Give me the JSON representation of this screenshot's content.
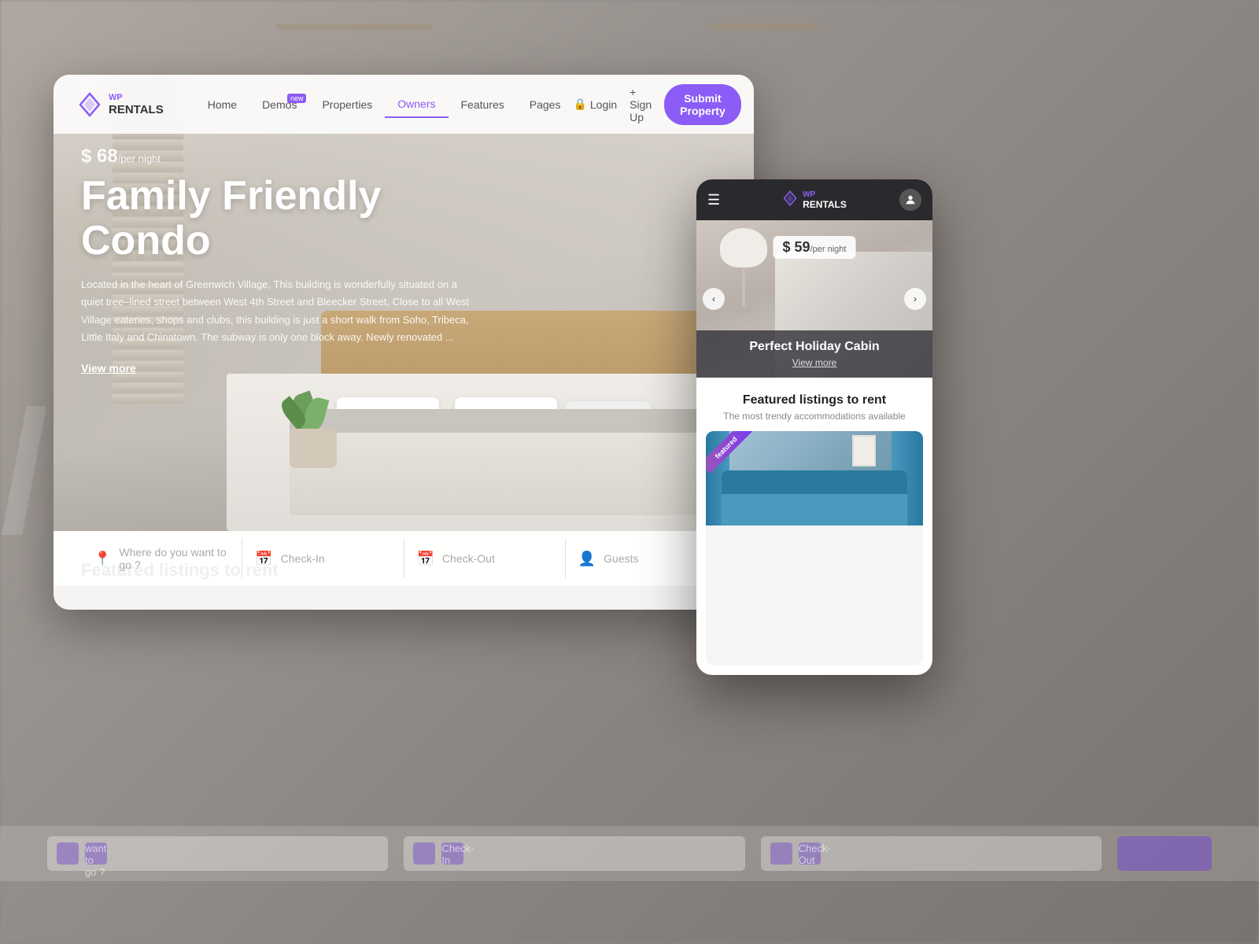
{
  "meta": {
    "title": "WP Rentals - Family Friendly Condo",
    "dimensions": "1600x1200"
  },
  "background": {
    "text": "/ R"
  },
  "desktop": {
    "navbar": {
      "logo": {
        "wp": "WP",
        "rentals": "RENTALS"
      },
      "links": [
        {
          "label": "Home",
          "active": false
        },
        {
          "label": "Demos",
          "active": false,
          "badge": "new"
        },
        {
          "label": "Properties",
          "active": false
        },
        {
          "label": "Owners",
          "active": true
        },
        {
          "label": "Features",
          "active": false
        },
        {
          "label": "Pages",
          "active": false
        }
      ],
      "login_label": "Login",
      "signup_label": "+ Sign Up",
      "submit_label": "Submit Property"
    },
    "hero": {
      "price": "$ 68",
      "price_unit": "/per night",
      "title": "Family Friendly Condo",
      "description": "Located in the heart of Greenwich Village, This building is wonderfully situated on a quiet tree–lined street between West 4th Street and Bleecker Street, Close to all West Village eateries, shops and clubs, this building is just a short walk from Soho, Tribeca, Little Italy and Chinatown. The subway is only one block away. Newly renovated ...",
      "view_more": "View more"
    },
    "search_bar": {
      "location_placeholder": "Where do you want to go ?",
      "checkin_placeholder": "Check-In",
      "checkout_placeholder": "Check-Out",
      "guests_placeholder": "Guests"
    },
    "featured_section": {
      "title": "Featured listings to rent"
    }
  },
  "mobile": {
    "navbar": {
      "wp": "WP",
      "rentals": "RENTALS",
      "menu_icon": "☰",
      "user_icon": "👤"
    },
    "hero": {
      "price": "$ 59",
      "price_unit": "/per night",
      "title": "Perfect Holiday Cabin",
      "view_more": "View more"
    },
    "featured": {
      "title": "Featured listings to rent",
      "subtitle": "The most trendy accommodations available"
    },
    "listing_badge": "featured",
    "arrows": {
      "left": "‹",
      "right": "›"
    }
  },
  "colors": {
    "primary": "#8b5cf6",
    "dark_bg": "#2a2a2e",
    "white": "#ffffff",
    "text_dark": "#333333",
    "text_mid": "#666666",
    "text_light": "#aaaaaa"
  }
}
